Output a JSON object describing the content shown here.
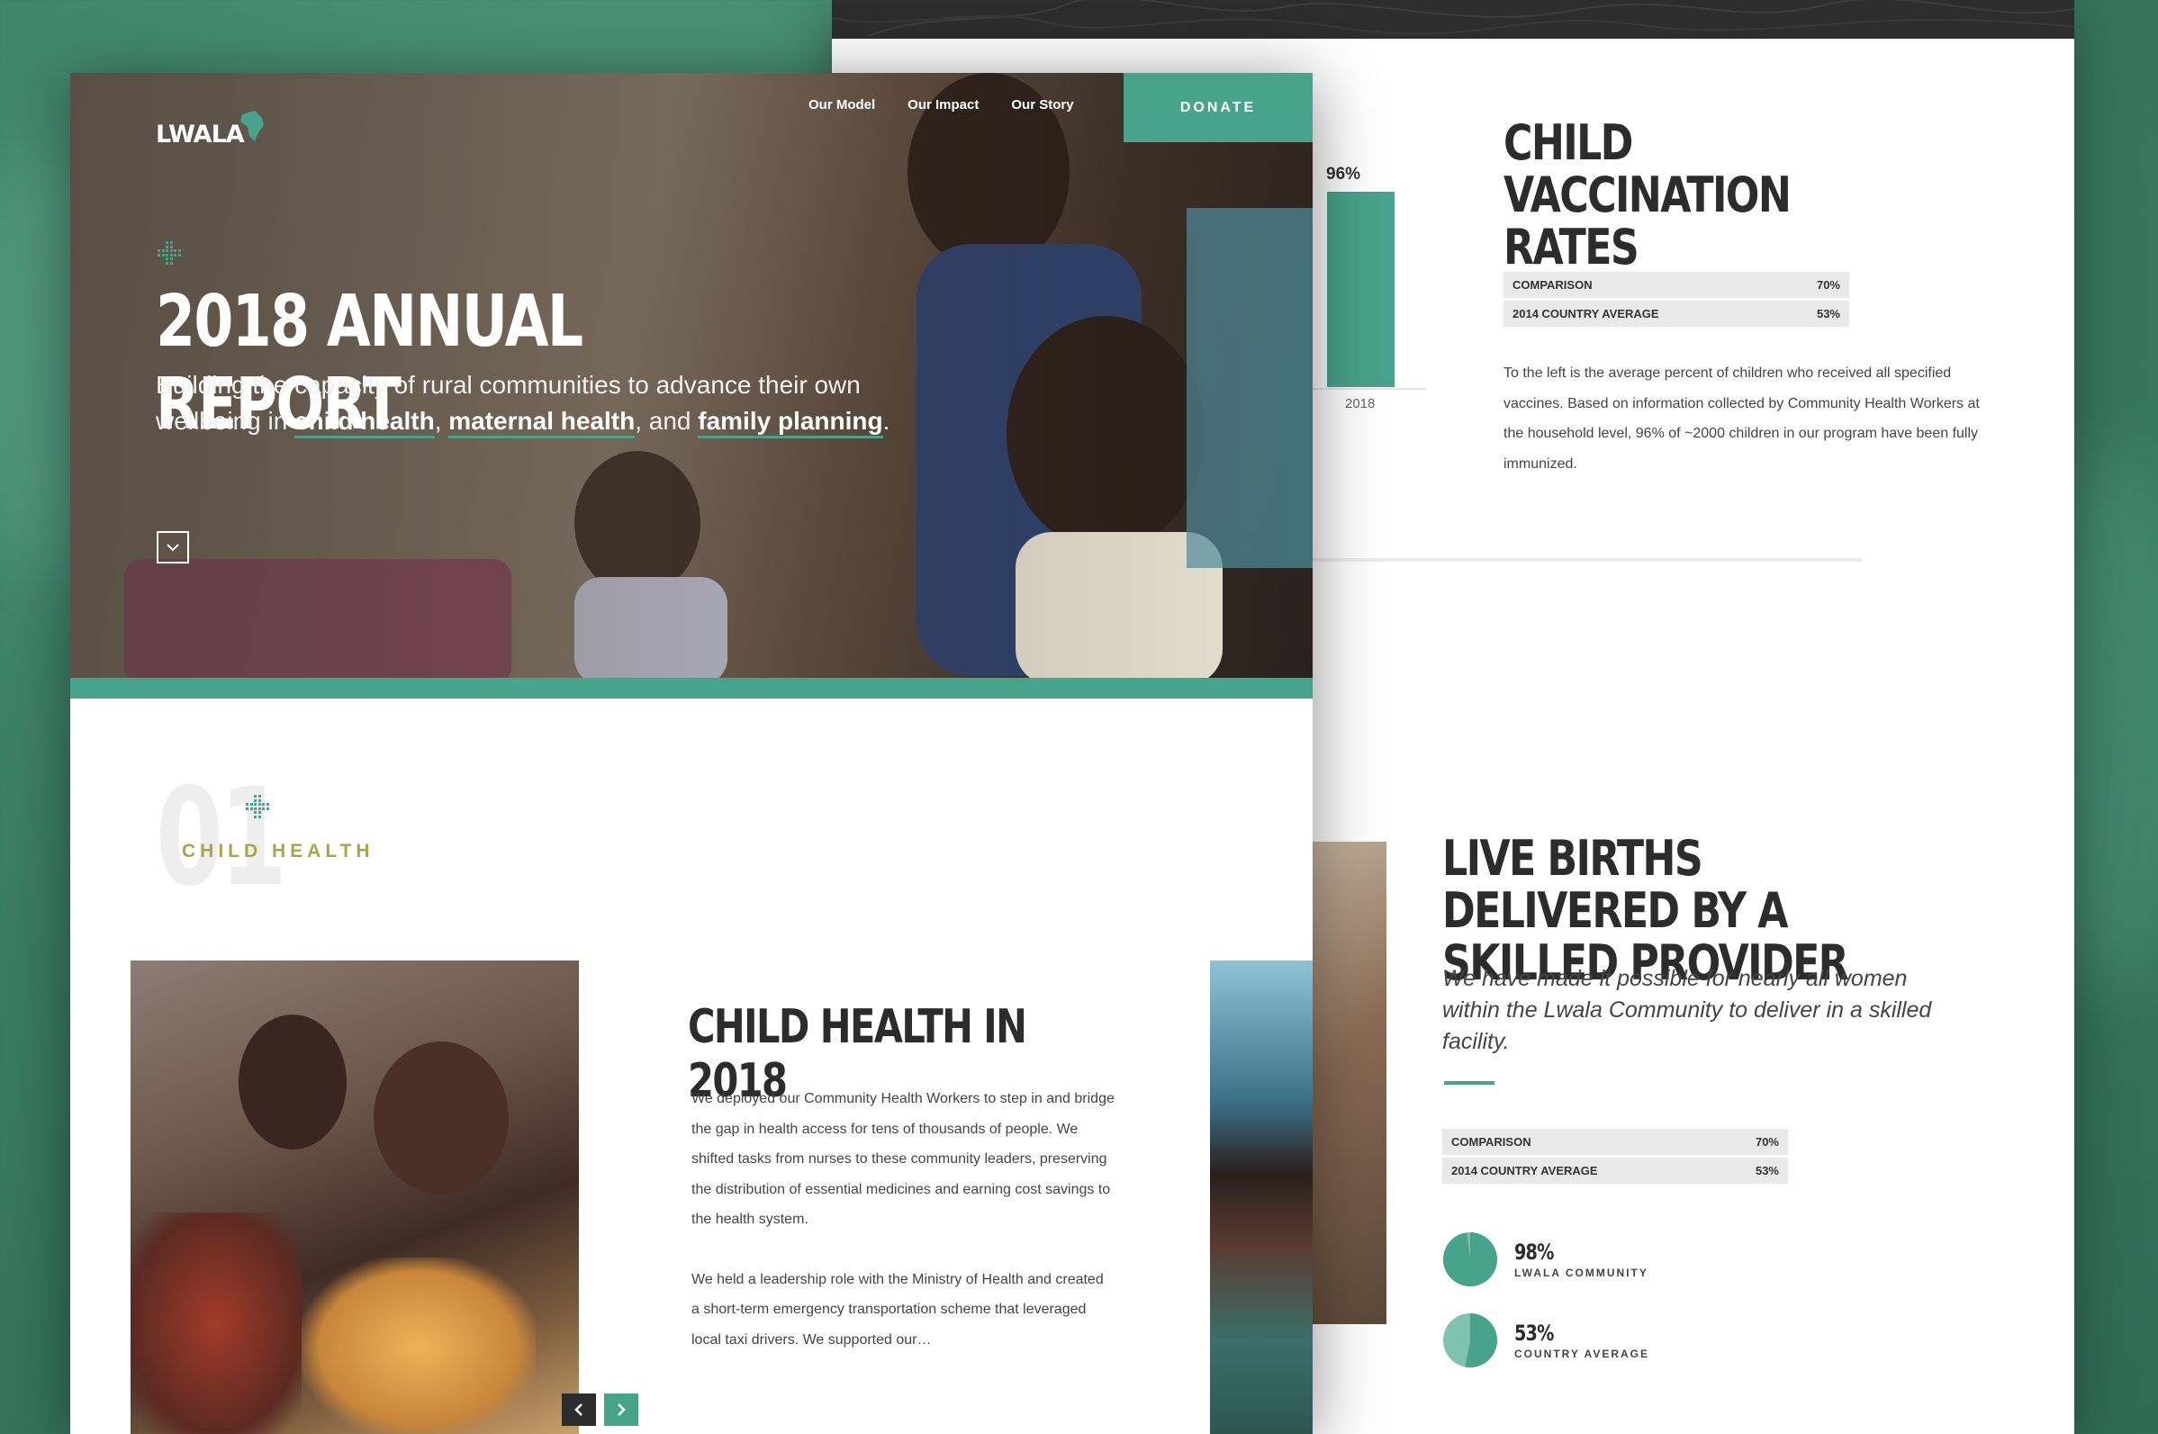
{
  "front": {
    "logo": "LWALA",
    "nav": [
      {
        "label": "Our Model"
      },
      {
        "label": "Our Impact"
      },
      {
        "label": "Our Story"
      }
    ],
    "donate_label": "DONATE",
    "hero": {
      "title": "2018 ANNUAL REPORT",
      "subtitle_prefix": "Building the capacity of rural communities to advance their own wellbeing in ",
      "highlight_1": "child health",
      "sep_1": ", ",
      "highlight_2": "maternal health",
      "sep_2": ", and ",
      "highlight_3": "family planning",
      "suffix": "."
    },
    "section": {
      "number": "01",
      "label": "CHILD HEALTH",
      "title": "CHILD HEALTH IN 2018",
      "paragraphs": [
        "We deployed our Community Health Workers to step in and bridge the gap in health access for tens of thousands of people. We shifted tasks from nurses to these community leaders, preserving the distribution of essential medicines and earning cost savings to the health system.",
        "We held a leadership role with the Ministry of Health and created a short-term emergency transportation scheme that leveraged local taxi drivers. We supported our…"
      ]
    }
  },
  "back": {
    "vaccination": {
      "title": "CHILD VACCINATION RATES",
      "comparison": [
        {
          "label": "COMPARISON",
          "value": "70%"
        },
        {
          "label": "2014 COUNTRY AVERAGE",
          "value": "53%"
        }
      ],
      "description": "To the left is the average percent of children who received all specified vaccines. Based on information collected by Community Health Workers at the household level, 96% of ~2000 children in our program have been fully immunized."
    },
    "births": {
      "title": "LIVE BIRTHS DELIVERED BY A SKILLED PROVIDER",
      "lead": "We have made it possible for nearly all women within the Lwala Community to deliver in a skilled facility.",
      "comparison": [
        {
          "label": "COMPARISON",
          "value": "70%"
        },
        {
          "label": "2014 COUNTRY AVERAGE",
          "value": "53%"
        }
      ],
      "pies": [
        {
          "value_label": "98%",
          "label": "LWALA COMMUNITY",
          "fraction": 0.98
        },
        {
          "value_label": "53%",
          "label": "COUNTRY AVERAGE",
          "fraction": 0.53
        }
      ]
    }
  },
  "chart_data": {
    "type": "bar",
    "categories": [
      "2018"
    ],
    "values": [
      96
    ],
    "data_labels": [
      "96%"
    ],
    "ylim": [
      0,
      100
    ]
  },
  "colors": {
    "accent": "#48a38c",
    "olive": "#a9a547",
    "dark_text": "#2c2c2c",
    "table_bg": "#e9e9e9"
  }
}
